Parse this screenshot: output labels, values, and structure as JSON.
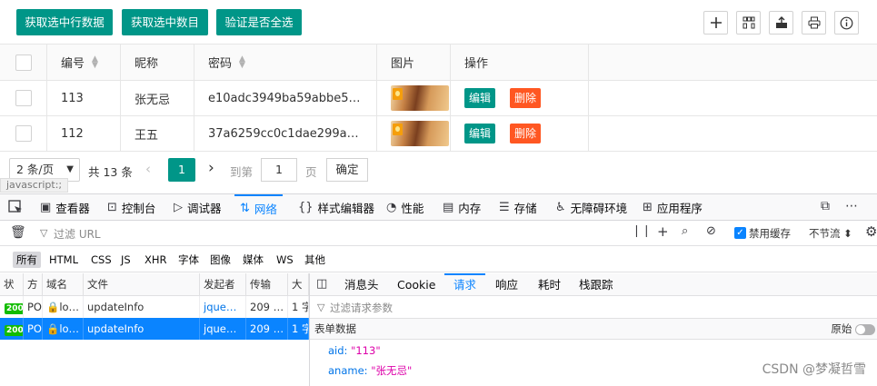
{
  "toolbar": {
    "buttons": [
      "获取选中行数据",
      "获取选中数目",
      "验证是否全选"
    ],
    "icons": [
      "add-icon",
      "columns-icon",
      "export-icon",
      "print-icon",
      "info-icon"
    ],
    "accent": "#009688"
  },
  "table": {
    "headers": [
      "编号",
      "昵称",
      "密码",
      "图片",
      "操作"
    ],
    "rows": [
      {
        "id": "113",
        "nickname": "张无忌",
        "password": "e10adc3949ba59abbe5…"
      },
      {
        "id": "112",
        "nickname": "王五",
        "password": "37a6259cc0c1dae299a…"
      }
    ],
    "edit_label": "编辑",
    "delete_label": "删除",
    "delete_color": "#ff5722"
  },
  "pager": {
    "page_size": "2 条/页",
    "total": "共 13 条",
    "current_page": "1",
    "goto_label": "到第",
    "goto_value": "1",
    "page_unit": "页",
    "confirm": "确定"
  },
  "status_url": "javascript:;",
  "devtools": {
    "tabs": [
      "查看器",
      "控制台",
      "调试器",
      "网络",
      "样式编辑器",
      "性能",
      "内存",
      "存储",
      "无障碍环境",
      "应用程序"
    ],
    "active_tab": "网络",
    "filter_placeholder": "过滤 URL",
    "disable_cache_label": "禁用缓存",
    "throttle_label": "不节流",
    "types": [
      "所有",
      "HTML",
      "CSS",
      "JS",
      "XHR",
      "字体",
      "图像",
      "媒体",
      "WS",
      "其他"
    ],
    "columns": [
      "状",
      "方",
      "域名",
      "文件",
      "发起者",
      "传输",
      "大"
    ],
    "requests": [
      {
        "status": "200",
        "method": "PO",
        "domain": "lo…",
        "file": "updateInfo",
        "initiator": "jque…",
        "transfer": "209 …",
        "size": "1 字"
      },
      {
        "status": "200",
        "method": "PO",
        "domain": "lo…",
        "file": "updateInfo",
        "initiator": "jque…",
        "transfer": "209 …",
        "size": "1 字"
      }
    ],
    "detail_tabs": [
      "消息头",
      "Cookie",
      "请求",
      "响应",
      "耗时",
      "栈跟踪"
    ],
    "detail_active": "请求",
    "params_placeholder": "过滤请求参数",
    "form_title": "表单数据",
    "raw_label": "原始",
    "form_data": [
      {
        "key": "aid:",
        "value": "\"113\""
      },
      {
        "key": "aname:",
        "value": "\"张无忌\""
      }
    ]
  },
  "watermark": "CSDN @梦凝哲雪"
}
